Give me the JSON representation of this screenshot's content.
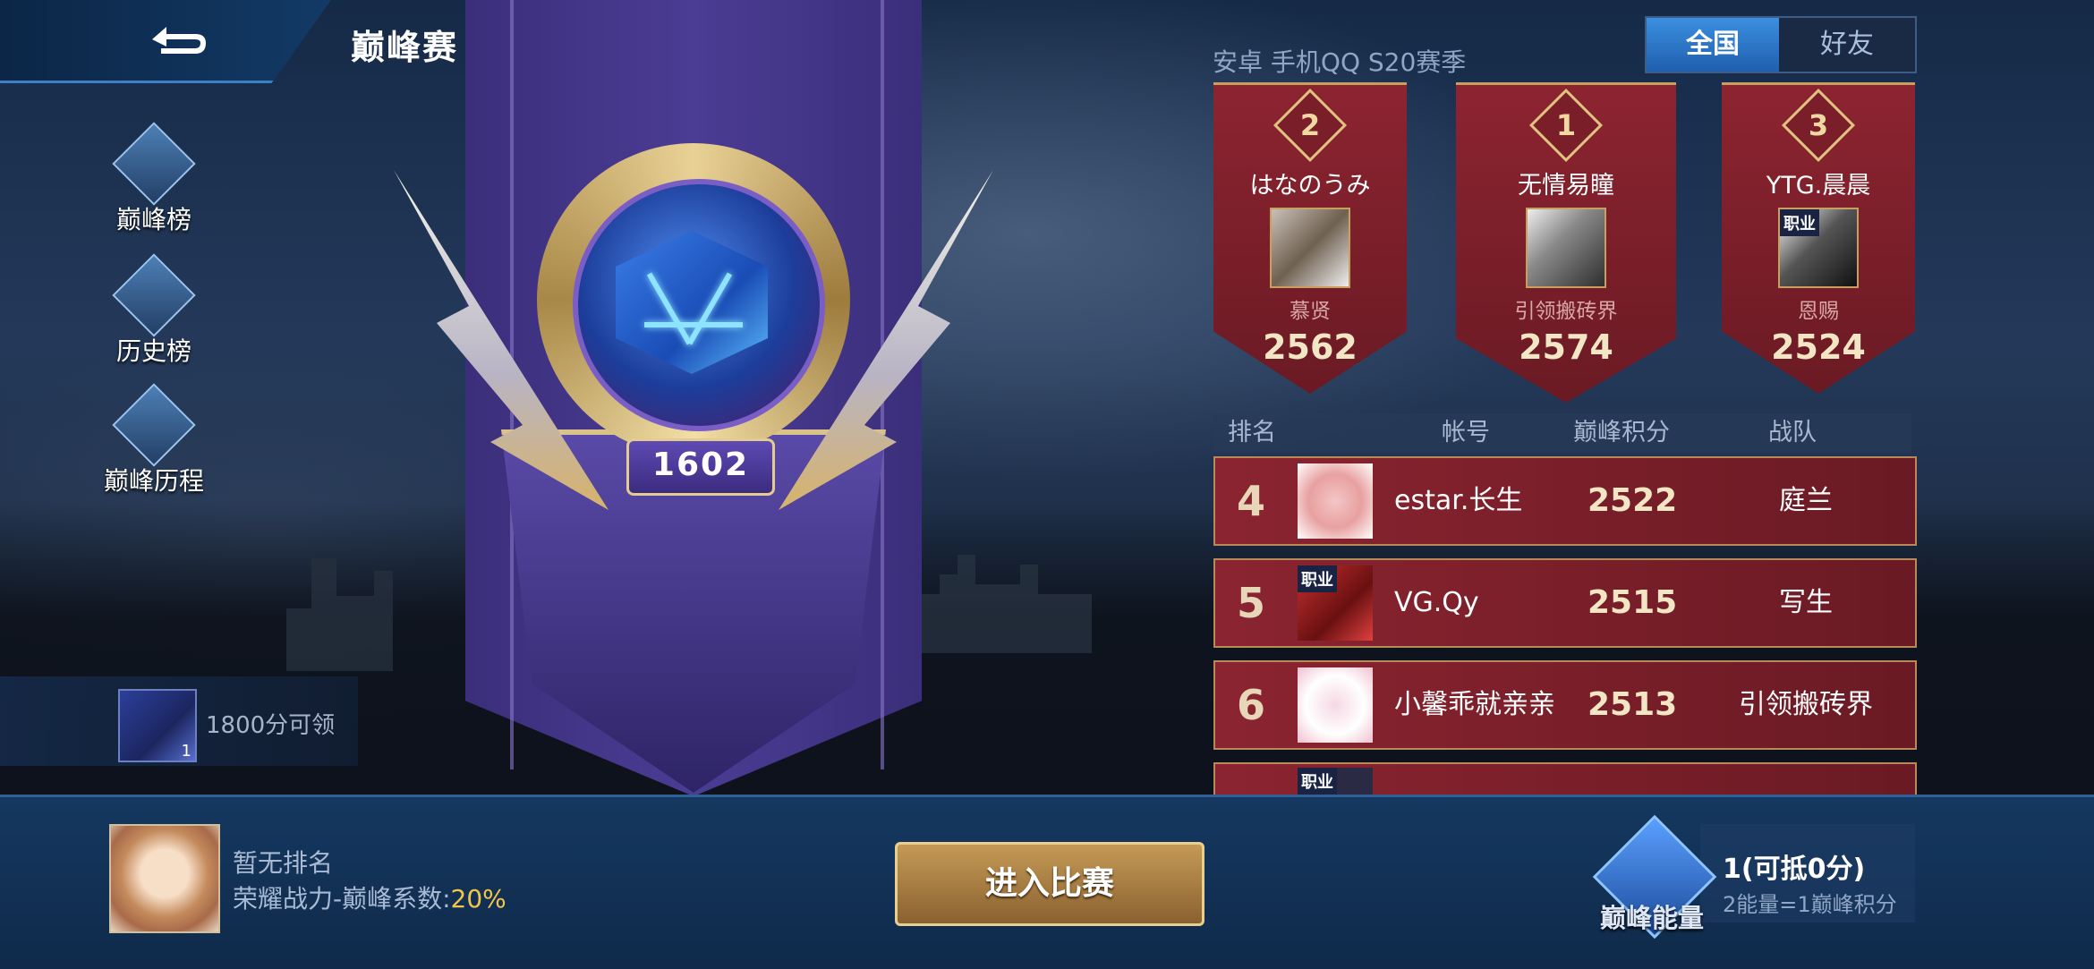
{
  "header": {
    "title": "巅峰赛",
    "help_glyph": "?"
  },
  "left_menu": [
    {
      "label": "巅峰榜",
      "icon": "leaderboard-icon"
    },
    {
      "label": "历史榜",
      "icon": "history-board-icon"
    },
    {
      "label": "巅峰历程",
      "icon": "journey-icon"
    }
  ],
  "reward": {
    "text": "1800分可领",
    "badge_num": "1"
  },
  "emblem": {
    "score": "1602"
  },
  "season": "安卓 手机QQ S20赛季",
  "tabs": {
    "national": "全国",
    "friends": "好友"
  },
  "top3": {
    "first": {
      "rank": "1",
      "name": "无情易瞳",
      "team": "引领搬砖界",
      "score": "2574"
    },
    "second": {
      "rank": "2",
      "name": "はなのうみ",
      "team": "慕贤",
      "score": "2562"
    },
    "third": {
      "rank": "3",
      "name": "YTG.晨晨",
      "team": "恩赐",
      "score": "2524",
      "tag": "职业"
    }
  },
  "list_header": {
    "rank": "排名",
    "account": "帐号",
    "score": "巅峰积分",
    "team": "战队"
  },
  "rows": [
    {
      "rank": "4",
      "name": "estar.长生",
      "score": "2522",
      "team": "庭兰"
    },
    {
      "rank": "5",
      "name": "VG.Qy",
      "score": "2515",
      "team": "写生",
      "tag": "职业"
    },
    {
      "rank": "6",
      "name": "小馨乖就亲亲",
      "score": "2513",
      "team": "引领搬砖界"
    }
  ],
  "partial_row_tag": "职业",
  "me": {
    "rank_text": "暂无排名",
    "coef_label": "荣耀战力-巅峰系数:",
    "coef_value": "20%"
  },
  "enter_button": "进入比赛",
  "energy": {
    "label": "巅峰能量",
    "value": "1(可抵0分)",
    "note": "2能量=1巅峰积分"
  }
}
